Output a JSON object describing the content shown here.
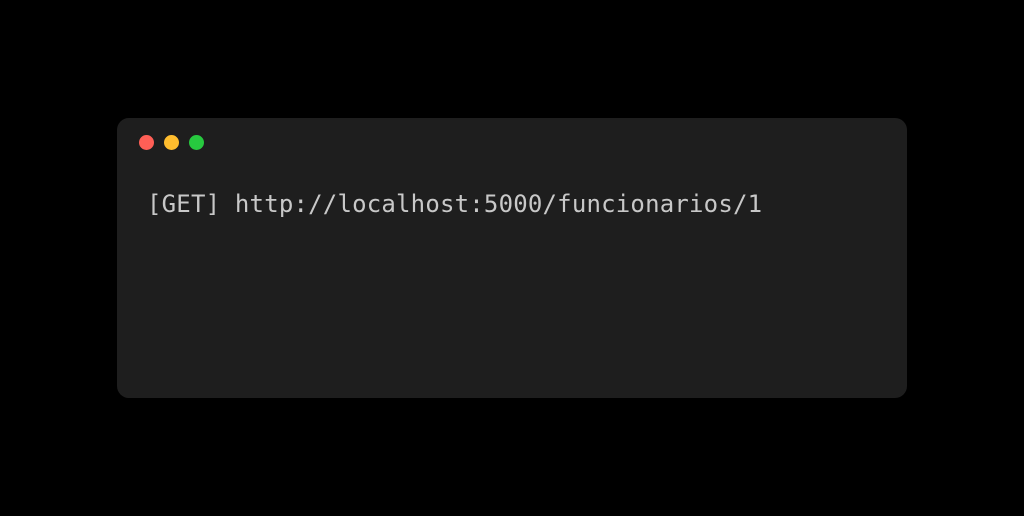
{
  "terminal": {
    "line": "[GET] http://localhost:5000/funcionarios/1"
  }
}
